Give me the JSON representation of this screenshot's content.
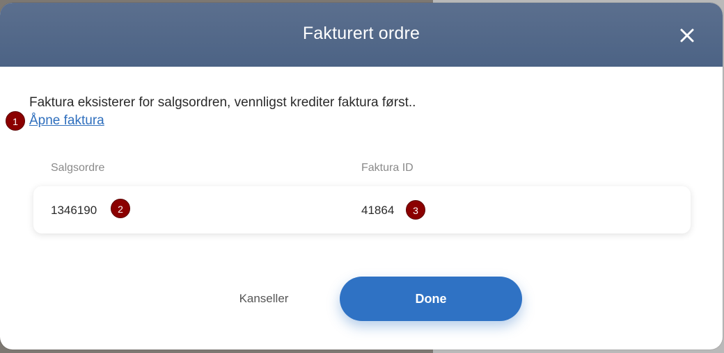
{
  "dialog": {
    "title": "Fakturert ordre",
    "message": "Faktura eksisterer for salgsordren, vennligst krediter faktura først..",
    "open_invoice_link": "Åpne faktura",
    "table": {
      "columns": [
        "Salgsordre",
        "Faktura ID"
      ],
      "rows": [
        {
          "salgsordre": "1346190",
          "faktura_id": "41864"
        }
      ]
    },
    "cancel_label": "Kanseller",
    "done_label": "Done"
  },
  "markers": [
    "1",
    "2",
    "3"
  ],
  "icons": {
    "close": "close-icon"
  },
  "colors": {
    "header": "#5b6f8e",
    "link": "#2f6fbd",
    "primary": "#2f72c4",
    "marker": "#8b0000"
  }
}
